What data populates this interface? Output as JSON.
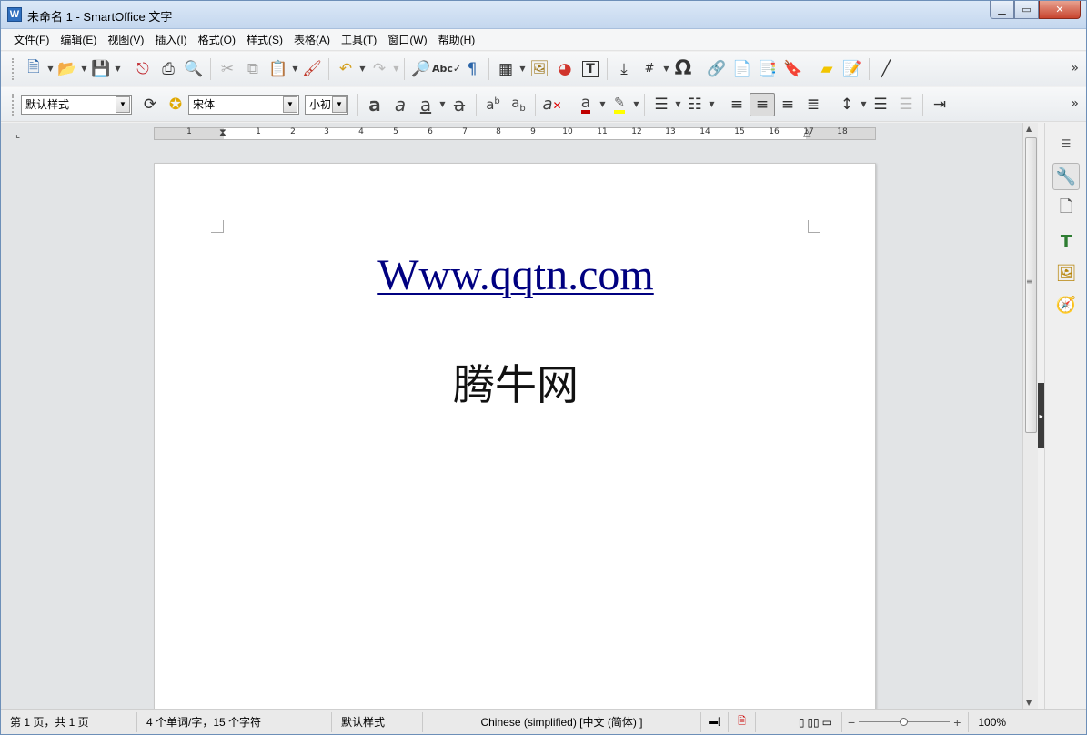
{
  "window": {
    "title": "未命名 1 - SmartOffice 文字",
    "app_icon": "W",
    "controls": [
      "minimize-icon",
      "maximize-icon",
      "close-icon"
    ]
  },
  "menu": {
    "items": [
      "文件(F)",
      "编辑(E)",
      "视图(V)",
      "插入(I)",
      "格式(O)",
      "样式(S)",
      "表格(A)",
      "工具(T)",
      "窗口(W)",
      "帮助(H)"
    ]
  },
  "formatting": {
    "paragraph_style": "默认样式",
    "font_name": "宋体",
    "font_size": "小初"
  },
  "ruler": {
    "numbers": [
      "1",
      "1",
      "2",
      "3",
      "4",
      "5",
      "6",
      "7",
      "8",
      "9",
      "10",
      "11",
      "12",
      "13",
      "14",
      "15",
      "16",
      "17",
      "18"
    ]
  },
  "document": {
    "link_text": "Www.qqtn.com",
    "chinese_text": "腾牛网"
  },
  "status": {
    "page_info": "第 1 页，共 1 页",
    "word_count": "4 个单词/字，15 个字符",
    "page_style": "默认样式",
    "language": "Chinese (simplified) [中文 (简体) ]",
    "zoom": "100%"
  },
  "colors": {
    "link": "#000080",
    "font_color_bar": "#c00000",
    "highlight_bar": "#ffff00",
    "titlebar": "#c4d7ee"
  }
}
